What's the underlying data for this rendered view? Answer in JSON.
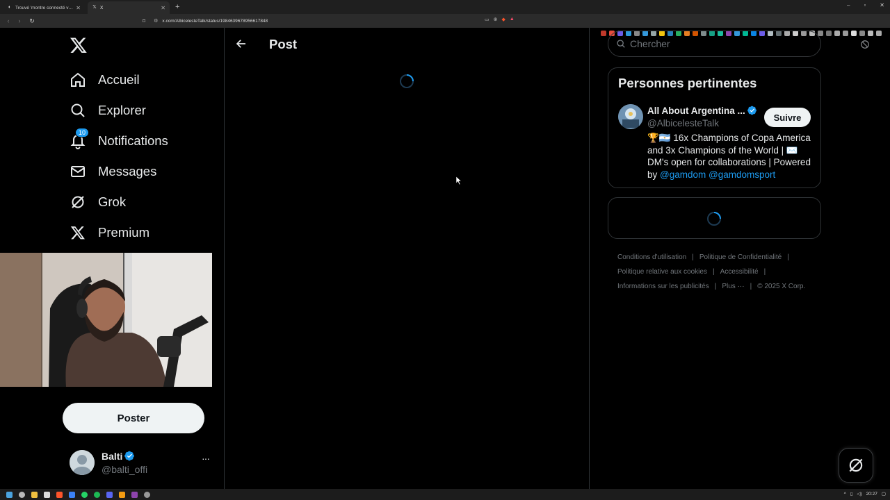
{
  "browser": {
    "tabs": [
      {
        "title": "Trouvé 'montre connecté vs réalité' -",
        "active": false
      },
      {
        "title": "X",
        "active": true
      }
    ],
    "url": "x.com/AlbicelesteTalk/status/1984639678956617848",
    "new_tab_label": "+",
    "window_controls": [
      "–",
      "▫",
      "✕"
    ]
  },
  "nav": {
    "items": [
      {
        "label": "Accueil",
        "icon": "home-icon"
      },
      {
        "label": "Explorer",
        "icon": "search-icon"
      },
      {
        "label": "Notifications",
        "icon": "bell-icon",
        "badge": "10"
      },
      {
        "label": "Messages",
        "icon": "mail-icon"
      },
      {
        "label": "Grok",
        "icon": "grok-icon"
      },
      {
        "label": "Premium",
        "icon": "x-icon"
      }
    ],
    "post_button": "Poster"
  },
  "account": {
    "name": "Balti",
    "handle": "@balti_offi",
    "more": "···"
  },
  "main": {
    "title": "Post"
  },
  "right": {
    "search_placeholder": "Chercher",
    "people_card_title": "Personnes pertinentes",
    "person": {
      "name": "All About Argentina ...",
      "handle": "@AlbicelesteTalk",
      "follow_label": "Suivre",
      "bio_prefix": "🏆🇦🇷 16x Champions of Copa America and 3x Champions of the World | ✉️ DM's open for collaborations | Powered by ",
      "bio_link1": "@gamdom",
      "bio_link2": "@gamdomsport"
    },
    "footer": {
      "line1": [
        "Conditions d'utilisation",
        "Politique de Confidentialité"
      ],
      "line2": [
        "Politique relative aux cookies",
        "Accessibilité"
      ],
      "line3": [
        "Informations sur les publicités",
        "Plus ···",
        "© 2025 X Corp."
      ]
    }
  },
  "taskbar": {
    "time": "20:27"
  },
  "colors": {
    "accent": "#1d9bf0",
    "background": "#000000",
    "border": "#2f3336"
  }
}
